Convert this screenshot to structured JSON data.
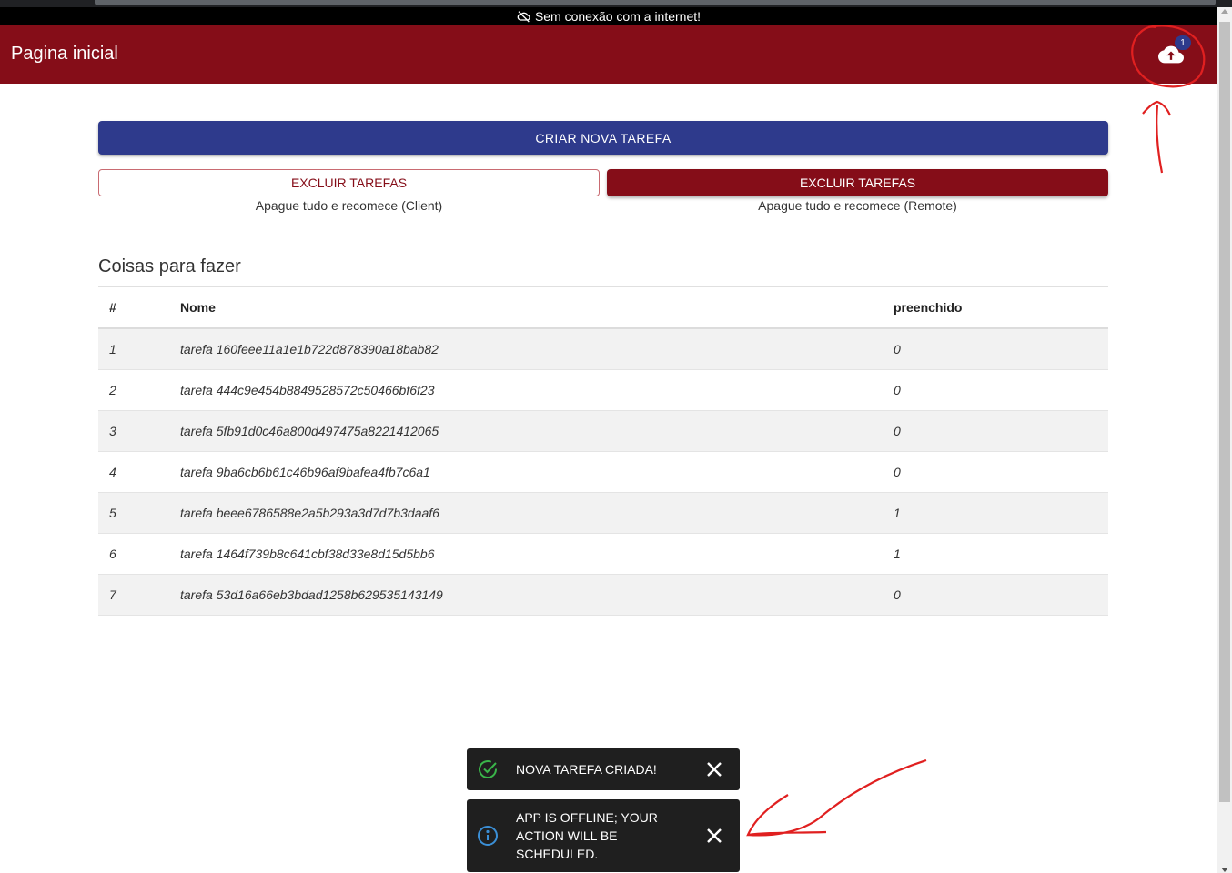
{
  "offline_banner": {
    "text": "Sem conexão com a internet!",
    "icon": "cloud-off-icon"
  },
  "appbar": {
    "title": "Pagina inicial",
    "sync_badge": "1",
    "icon": "cloud-upload-icon",
    "color": "#850d18"
  },
  "actions": {
    "create_label": "CRIAR NOVA TAREFA",
    "delete_client_label": "EXCLUIR TAREFAS",
    "delete_client_caption": "Apague tudo e recomece (Client)",
    "delete_remote_label": "EXCLUIR TAREFAS",
    "delete_remote_caption": "Apague tudo e recomece (Remote)"
  },
  "section": {
    "title": "Coisas para fazer"
  },
  "table": {
    "headers": [
      "#",
      "Nome",
      "preenchido"
    ],
    "rows": [
      [
        "1",
        "tarefa 160feee11a1e1b722d878390a18bab82",
        "0"
      ],
      [
        "2",
        "tarefa 444c9e454b8849528572c50466bf6f23",
        "0"
      ],
      [
        "3",
        "tarefa 5fb91d0c46a800d497475a8221412065",
        "0"
      ],
      [
        "4",
        "tarefa 9ba6cb6b61c46b96af9bafea4fb7c6a1",
        "0"
      ],
      [
        "5",
        "tarefa beee6786588e2a5b293a3d7d7b3daaf6",
        "1"
      ],
      [
        "6",
        "tarefa 1464f739b8c641cbf38d33e8d15d5bb6",
        "1"
      ],
      [
        "7",
        "tarefa 53d16a66eb3bdad1258b629535143149",
        "0"
      ]
    ]
  },
  "toasts": [
    {
      "message": "Nova tarefa criada!",
      "icon": "check-circle-icon",
      "color": "#3ab54a"
    },
    {
      "message": "App is offline; your action will be scheduled.",
      "icon": "info-icon",
      "color": "#3b8fd6"
    }
  ],
  "colors": {
    "primary": "#2e3a8c",
    "brand": "#850d18",
    "annotation": "#e02020"
  }
}
